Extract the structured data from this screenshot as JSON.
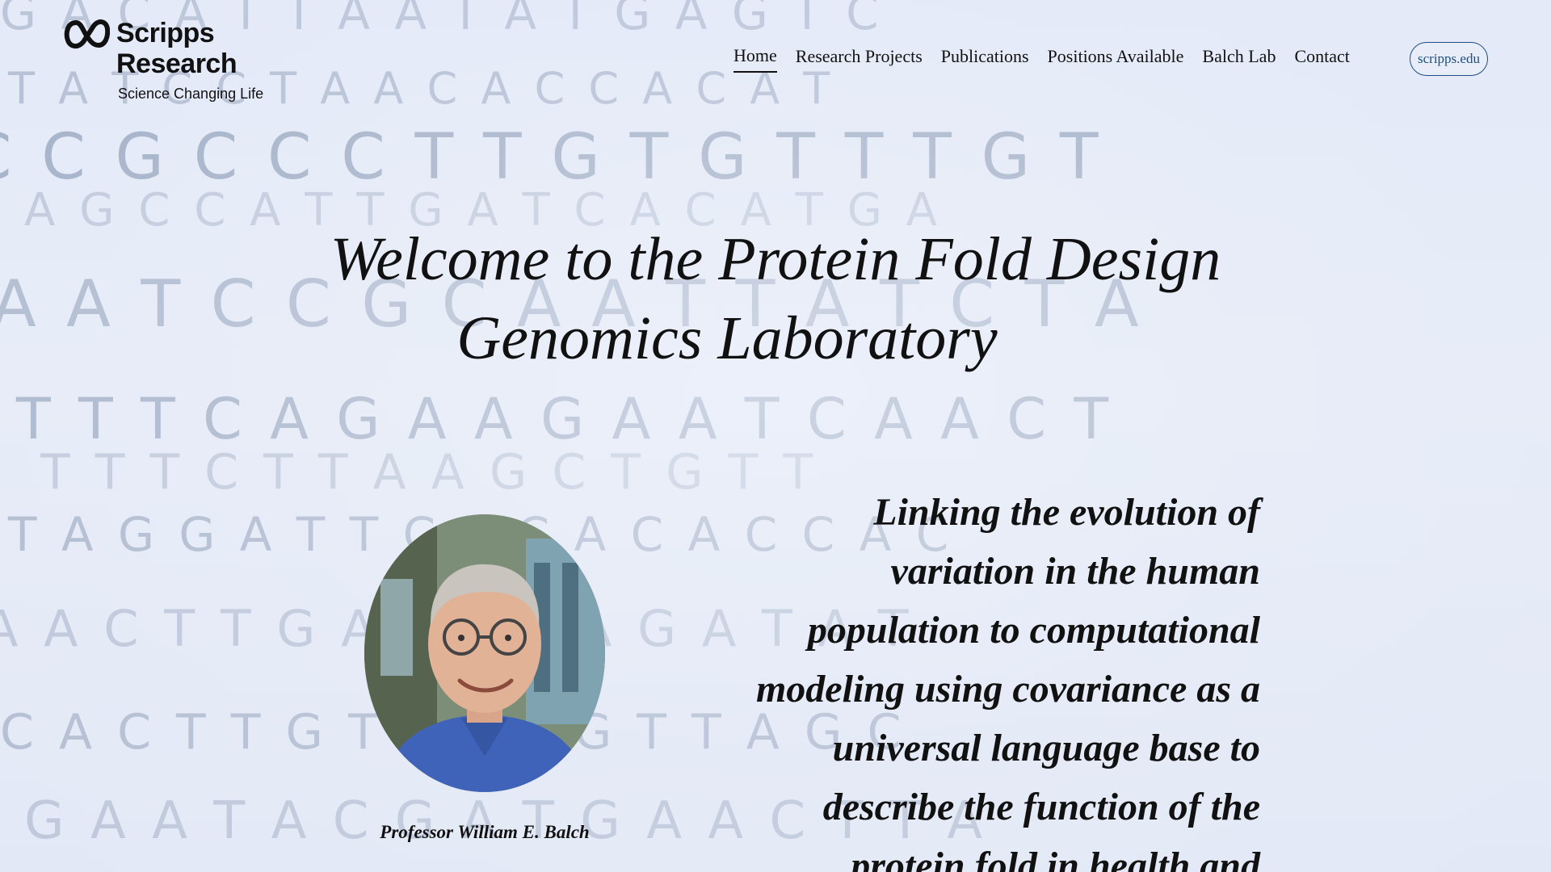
{
  "logo": {
    "line1": "Scripps",
    "line2": "Research",
    "tagline": "Science Changing Life",
    "icon": "infinity-logo-icon"
  },
  "nav": {
    "items": [
      {
        "label": "Home",
        "active": true
      },
      {
        "label": "Research Projects",
        "active": false
      },
      {
        "label": "Publications",
        "active": false
      },
      {
        "label": "Positions Available",
        "active": false
      },
      {
        "label": "Balch Lab",
        "active": false
      },
      {
        "label": "Contact",
        "active": false
      }
    ],
    "external_link": "scripps.edu"
  },
  "hero": {
    "title_line1": "Welcome to the Protein Fold Design",
    "title_line2": "Genomics Laboratory"
  },
  "profile": {
    "caption": "Professor William E. Balch"
  },
  "tagline": {
    "lines": [
      "Linking the evolution of",
      "variation in the human",
      "population to computational",
      "modeling using covariance as a",
      "universal language base to",
      "describe the function of the",
      "protein fold in health and"
    ]
  },
  "background": {
    "rows": [
      "G  A  C  A  T  T  A  A  T  A  T  G  A  G  T  C",
      "T  A  T  C  C  T  A  A  C  A  C  C  A  C  A  T",
      "C  C  G  C  C  C  T  T  G  T  G  T  T  T  G  T",
      "A  G  C  C  A  T  T  G  A  T  C  A  C  A  T  G  A",
      "A  A  T  C  C  G  C  A  A  T  T  A  T  C  T  A",
      "T  T  T  C  A  G  A  A  G  A  A  T  C  A  A  C  T",
      "T  T  T  C  T  T  A  A  G  C  T  G  T  T",
      "T  A  G  G  A  T  T  C  A  C  A  C  A  C  C  A  C",
      "A  A  C  T  T  G  A  C  T  A  A  G  A  T  A  T",
      "C  A  C  T  T  G  T  A  A  T  G  T  T  A  G  C",
      "G  A  A  T  A  C  G  A  T  G  A  A  C  T  T  A"
    ],
    "text_color": "#5f7394",
    "base_color": "#e3e9f7"
  },
  "colors": {
    "text": "#111111",
    "pill_border": "#1b4f86"
  }
}
